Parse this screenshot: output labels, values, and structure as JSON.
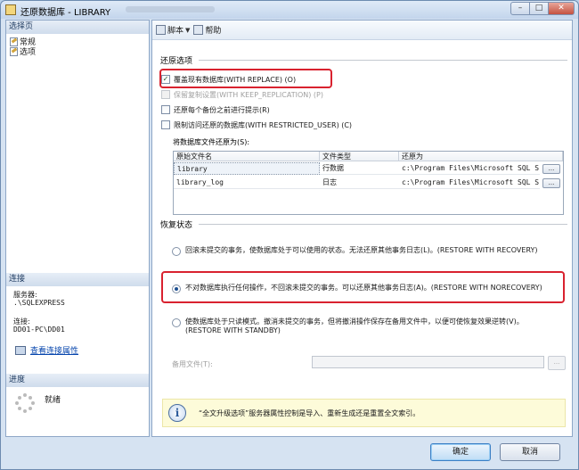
{
  "window": {
    "title": "还原数据库 - LIBRARY"
  },
  "left": {
    "select_page_header": "选择页",
    "pages": [
      "常规",
      "选项"
    ],
    "connection_header": "连接",
    "server_label": "服务器:",
    "server_value": ".\\SQLEXPRESS",
    "connection_label": "连接:",
    "connection_value": "DD01-PC\\DD01",
    "view_connection_link": "查看连接属性",
    "progress_header": "进度",
    "progress_status": "就绪"
  },
  "toolbar": {
    "script_label": "脚本",
    "help_label": "帮助"
  },
  "restore_options": {
    "header": "还原选项",
    "overwrite": {
      "label": "覆盖现有数据库(WITH REPLACE) (O)",
      "checked": true
    },
    "keep_replication": {
      "label": "保留复制设置(WITH KEEP_REPLICATION) (P)",
      "checked": false
    },
    "prompt_each": {
      "label": "还原每个备份之前进行提示(R)",
      "checked": false
    },
    "restrict_access": {
      "label": "限制访问还原的数据库(WITH RESTRICTED_USER) (C)",
      "checked": false
    },
    "restore_as_label": "将数据库文件还原为(S):",
    "columns": [
      "原始文件名",
      "文件类型",
      "还原为"
    ],
    "files": [
      {
        "name": "library",
        "type": "行数据",
        "restore_as": "c:\\Program Files\\Microsoft SQL S...",
        "browse": "..."
      },
      {
        "name": "library_log",
        "type": "日志",
        "restore_as": "c:\\Program Files\\Microsoft SQL S...",
        "browse": "..."
      }
    ]
  },
  "recovery": {
    "header": "恢复状态",
    "with_recovery": "回滚未提交的事务，使数据库处于可以使用的状态。无法还原其他事务日志(L)。(RESTORE WITH RECOVERY)",
    "with_norecovery": "不对数据库执行任何操作，不回滚未提交的事务。可以还原其他事务日志(A)。(RESTORE WITH NORECOVERY)",
    "with_standby_line1": "使数据库处于只读模式。撤消未提交的事务，但将撤消操作保存在备用文件中，以便可使恢复效果逆转(V)。",
    "with_standby_line2": "(RESTORE WITH STANDBY)",
    "selected": "with_norecovery",
    "standby_file_label": "备用文件(T):",
    "standby_file_value": "",
    "standby_browse": "..."
  },
  "info": {
    "text": "“全文升级选项”服务器属性控制是导入、重新生成还是重置全文索引。"
  },
  "buttons": {
    "ok": "确定",
    "cancel": "取消"
  },
  "colors": {
    "highlight_box": "#d9222f",
    "title_bar": "#c3d5ec"
  }
}
